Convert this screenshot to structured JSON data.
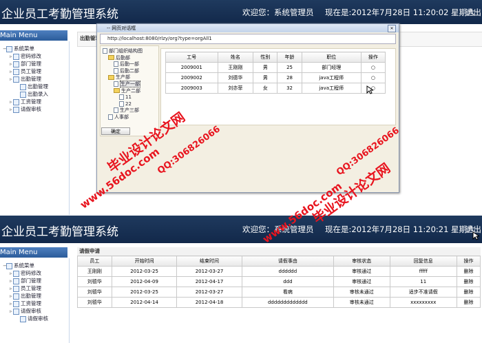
{
  "top": {
    "title": "企业员工考勤管理系统",
    "welcome": "欢迎您：系统管理员",
    "now": "现在是:2012年7月28日 11:20:02 星期六",
    "logout": "退出",
    "menu_title": "Main Menu",
    "tree": [
      {
        "label": "系统菜单",
        "level": 0
      },
      {
        "label": "密码修改",
        "level": 1
      },
      {
        "label": "部门管理",
        "level": 1
      },
      {
        "label": "员工管理",
        "level": 1
      },
      {
        "label": "出勤管理",
        "level": 1
      },
      {
        "label": "出勤管理",
        "level": 2
      },
      {
        "label": "出勤录入",
        "level": 2
      },
      {
        "label": "工资管理",
        "level": 1
      },
      {
        "label": "请假审核",
        "level": 1
      }
    ],
    "content_label": "出勤管理",
    "dialog": {
      "title": "-- 网页对话框",
      "url": "http://localhost:8080/rlzy/org?type=orgAll1",
      "tree": [
        {
          "label": "部门组织结构图",
          "icon": "doc",
          "level": 0
        },
        {
          "label": "后勤部",
          "icon": "folder",
          "level": 1
        },
        {
          "label": "后勤一部",
          "icon": "doc",
          "level": 2
        },
        {
          "label": "后勤二部",
          "icon": "doc",
          "level": 2
        },
        {
          "label": "生产部",
          "icon": "folder",
          "level": 1
        },
        {
          "label": "生产一部",
          "icon": "doc",
          "level": 2
        },
        {
          "label": "生产二部",
          "icon": "folder",
          "level": 2
        },
        {
          "label": "11",
          "icon": "doc",
          "level": 3
        },
        {
          "label": "22",
          "icon": "doc",
          "level": 3
        },
        {
          "label": "生产三部",
          "icon": "doc",
          "level": 2
        },
        {
          "label": "人事部",
          "icon": "doc",
          "level": 1
        }
      ],
      "confirm": "确定",
      "columns": [
        "工号",
        "姓名",
        "性别",
        "年龄",
        "职位",
        "操作"
      ],
      "rows": [
        [
          "2009001",
          "王刚刚",
          "男",
          "25",
          "部门经理",
          "○"
        ],
        [
          "2009002",
          "刘德华",
          "男",
          "28",
          "java工程师",
          "○"
        ],
        [
          "2009003",
          "刘亦菲",
          "女",
          "32",
          "java工程师",
          "○"
        ]
      ]
    }
  },
  "bottom": {
    "title": "企业员工考勤管理系统",
    "welcome": "欢迎您：系统管理员",
    "now": "现在是:2012年7月28日 11:20:21 星期六",
    "logout": "退出",
    "menu_title": "Main Menu",
    "tree": [
      {
        "label": "系统菜单",
        "level": 0
      },
      {
        "label": "密码修改",
        "level": 1
      },
      {
        "label": "部门管理",
        "level": 1
      },
      {
        "label": "员工管理",
        "level": 1
      },
      {
        "label": "出勤管理",
        "level": 1
      },
      {
        "label": "工资管理",
        "level": 1
      },
      {
        "label": "请假审核",
        "level": 1
      },
      {
        "label": "请假审核",
        "level": 2
      }
    ],
    "section_title": "请假申请",
    "columns": [
      "员工",
      "开始时间",
      "结束时间",
      "请假事由",
      "审核状态",
      "回复信息",
      "操作"
    ],
    "rows": [
      [
        "王刚刚",
        "2012-03-25",
        "2012-03-27",
        "dddddd",
        "审核通过",
        "fffff",
        "删除"
      ],
      [
        "刘德华",
        "2012-04-09",
        "2012-04-17",
        "ddd",
        "审核通过",
        "11",
        "删除"
      ],
      [
        "刘德华",
        "2012-03-25",
        "2012-03-27",
        "看病",
        "审核未通过",
        "适步不准请假",
        "删除"
      ],
      [
        "刘德华",
        "2012-04-14",
        "2012-04-18",
        "ddddddddddddd",
        "审核未通过",
        "xxxxxxxxx",
        "删除"
      ]
    ]
  },
  "watermarks": {
    "url": "www.56doc.com",
    "qq": "QQ:306826066",
    "brand": "毕业设计论文网"
  },
  "colors": {
    "header": "#1a3356",
    "watermark": "#e8141e"
  }
}
